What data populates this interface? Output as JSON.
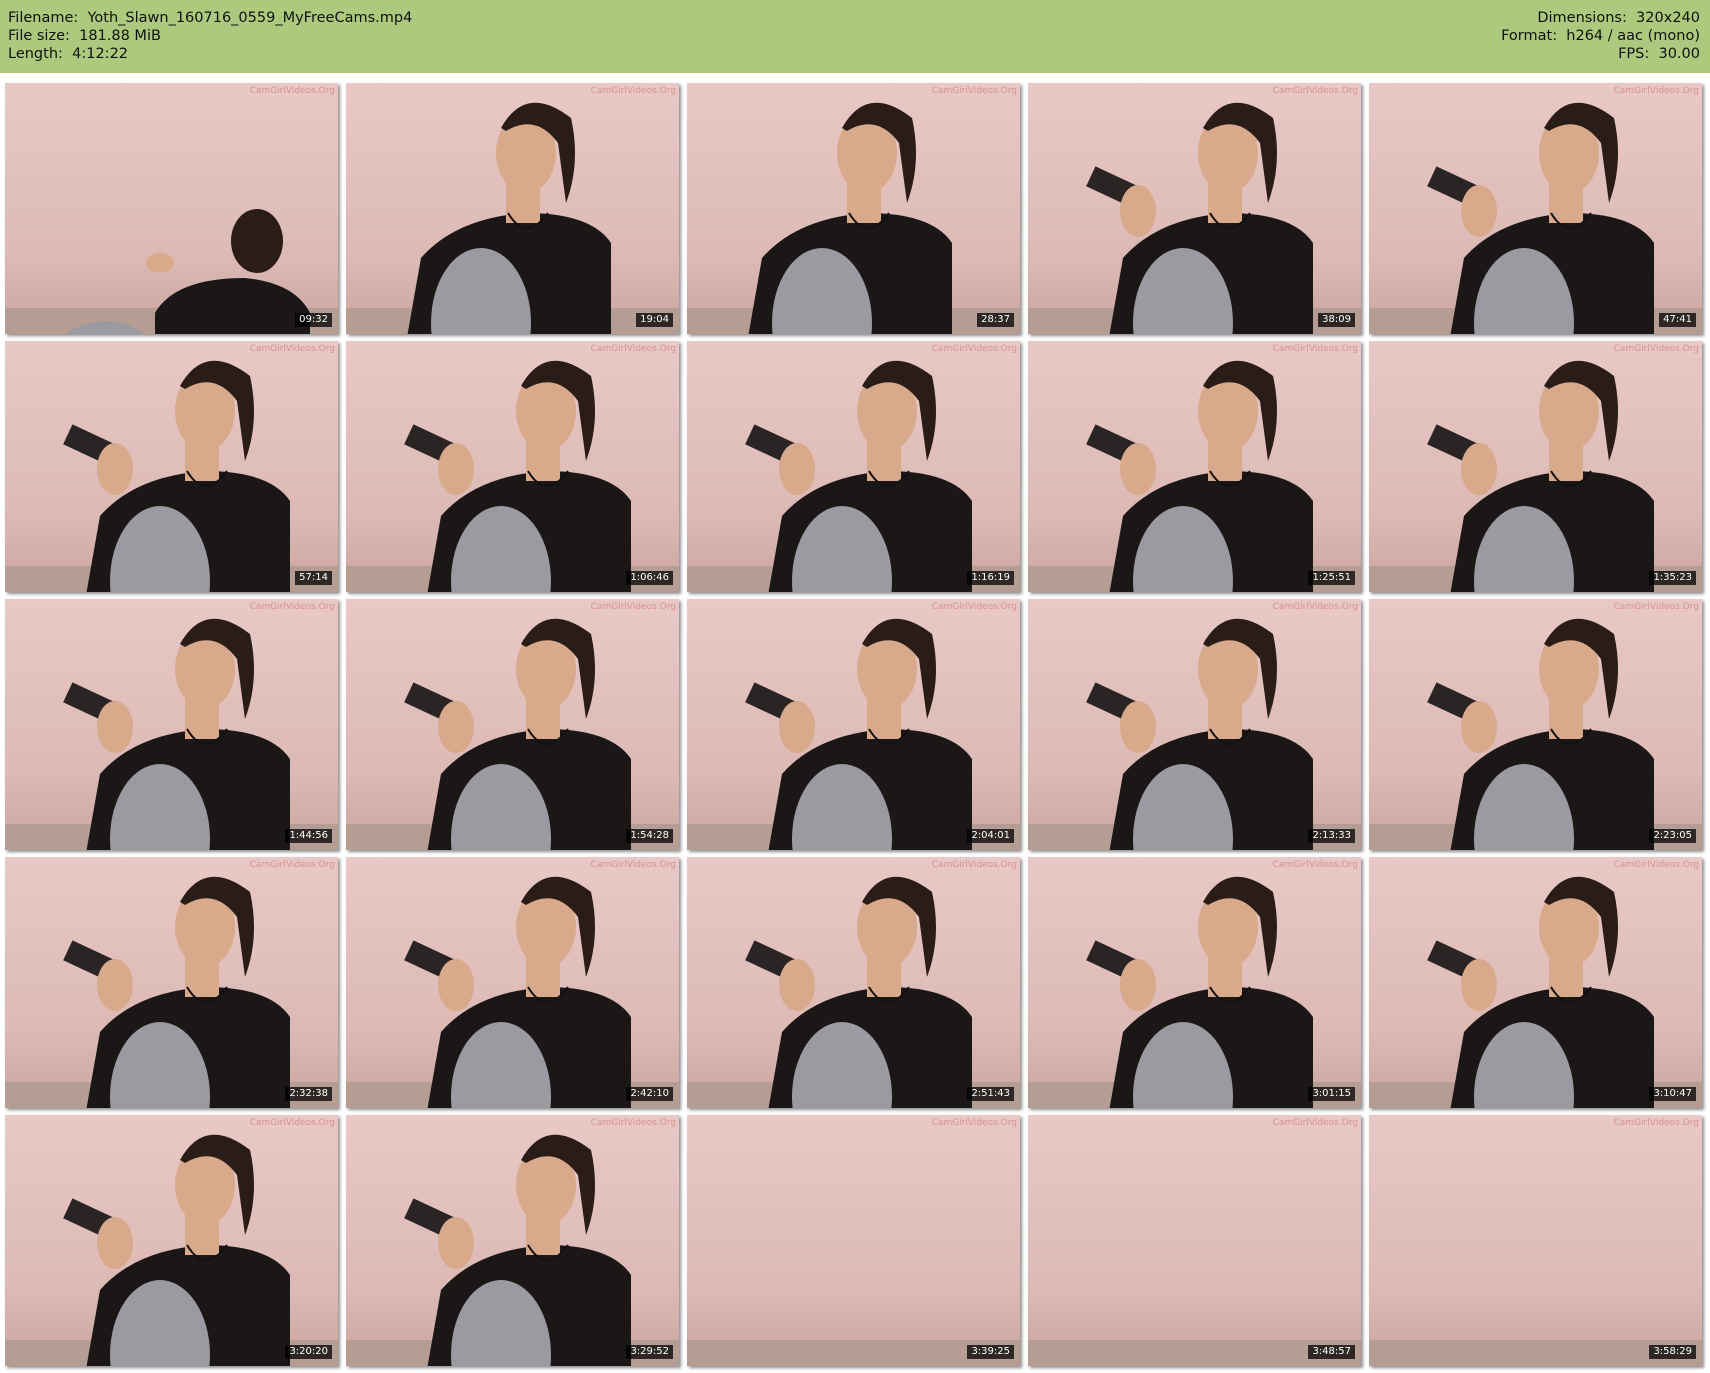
{
  "header": {
    "filename_line": "Filename:  Yoth_Slawn_160716_0559_MyFreeCams.mp4",
    "filesize_line": "File size:  181.88 MiB",
    "length_line": "Length:  4:12:22",
    "dimensions_line": "Dimensions:  320x240",
    "format_line": "Format:  h264 / aac (mono)",
    "fps_line": "FPS:  30.00"
  },
  "watermark": "CamGirlVideos.Org",
  "thumbnails": [
    {
      "timestamp": "09:32",
      "scene": "back"
    },
    {
      "timestamp": "19:04",
      "scene": "front"
    },
    {
      "timestamp": "28:37",
      "scene": "front"
    },
    {
      "timestamp": "38:09",
      "scene": "side"
    },
    {
      "timestamp": "47:41",
      "scene": "side"
    },
    {
      "timestamp": "57:14",
      "scene": "side"
    },
    {
      "timestamp": "1:06:46",
      "scene": "side"
    },
    {
      "timestamp": "1:16:19",
      "scene": "side"
    },
    {
      "timestamp": "1:25:51",
      "scene": "side"
    },
    {
      "timestamp": "1:35:23",
      "scene": "side"
    },
    {
      "timestamp": "1:44:56",
      "scene": "side"
    },
    {
      "timestamp": "1:54:28",
      "scene": "side"
    },
    {
      "timestamp": "2:04:01",
      "scene": "side"
    },
    {
      "timestamp": "2:13:33",
      "scene": "side"
    },
    {
      "timestamp": "2:23:05",
      "scene": "side"
    },
    {
      "timestamp": "2:32:38",
      "scene": "side"
    },
    {
      "timestamp": "2:42:10",
      "scene": "side"
    },
    {
      "timestamp": "2:51:43",
      "scene": "side"
    },
    {
      "timestamp": "3:01:15",
      "scene": "side"
    },
    {
      "timestamp": "3:10:47",
      "scene": "side"
    },
    {
      "timestamp": "3:20:20",
      "scene": "side"
    },
    {
      "timestamp": "3:29:52",
      "scene": "side"
    },
    {
      "timestamp": "3:39:25",
      "scene": "empty"
    },
    {
      "timestamp": "3:48:57",
      "scene": "empty"
    },
    {
      "timestamp": "3:58:29",
      "scene": "empty"
    }
  ],
  "colors": {
    "header_bg": "#acc97d",
    "wall": "#e8c9c6",
    "shirt": "#1b1717",
    "pillow": "#9a9aa0",
    "hair": "#2a1c16",
    "skin": "#d9a98c"
  }
}
